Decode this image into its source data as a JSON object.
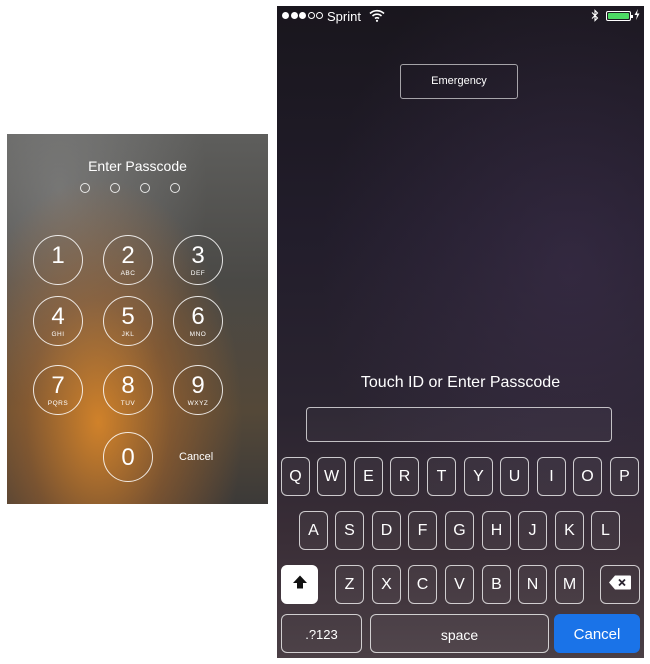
{
  "left_panel": {
    "title": "Enter Passcode",
    "keys": [
      {
        "num": "1",
        "letters": ""
      },
      {
        "num": "2",
        "letters": "ABC"
      },
      {
        "num": "3",
        "letters": "DEF"
      },
      {
        "num": "4",
        "letters": "GHI"
      },
      {
        "num": "5",
        "letters": "JKL"
      },
      {
        "num": "6",
        "letters": "MNO"
      },
      {
        "num": "7",
        "letters": "PQRS"
      },
      {
        "num": "8",
        "letters": "TUV"
      },
      {
        "num": "9",
        "letters": "WXYZ"
      },
      {
        "num": "0",
        "letters": ""
      }
    ],
    "cancel_label": "Cancel"
  },
  "right_panel": {
    "status_bar": {
      "carrier": "Sprint",
      "signal_bars_filled": 3,
      "signal_bars_total": 5,
      "icons": [
        "wifi-icon",
        "bluetooth-icon",
        "battery-icon",
        "charging-bolt-icon"
      ],
      "battery_color": "#4cd964"
    },
    "emergency_label": "Emergency",
    "prompt": "Touch ID or Enter Passcode",
    "keyboard": {
      "row1": [
        "Q",
        "W",
        "E",
        "R",
        "T",
        "Y",
        "U",
        "I",
        "O",
        "P"
      ],
      "row2": [
        "A",
        "S",
        "D",
        "F",
        "G",
        "H",
        "J",
        "K",
        "L"
      ],
      "row3": [
        "Z",
        "X",
        "C",
        "V",
        "B",
        "N",
        "M"
      ],
      "numbers_label": ".?123",
      "space_label": "space",
      "cancel_label": "Cancel",
      "cancel_color": "#1a73e8"
    }
  }
}
